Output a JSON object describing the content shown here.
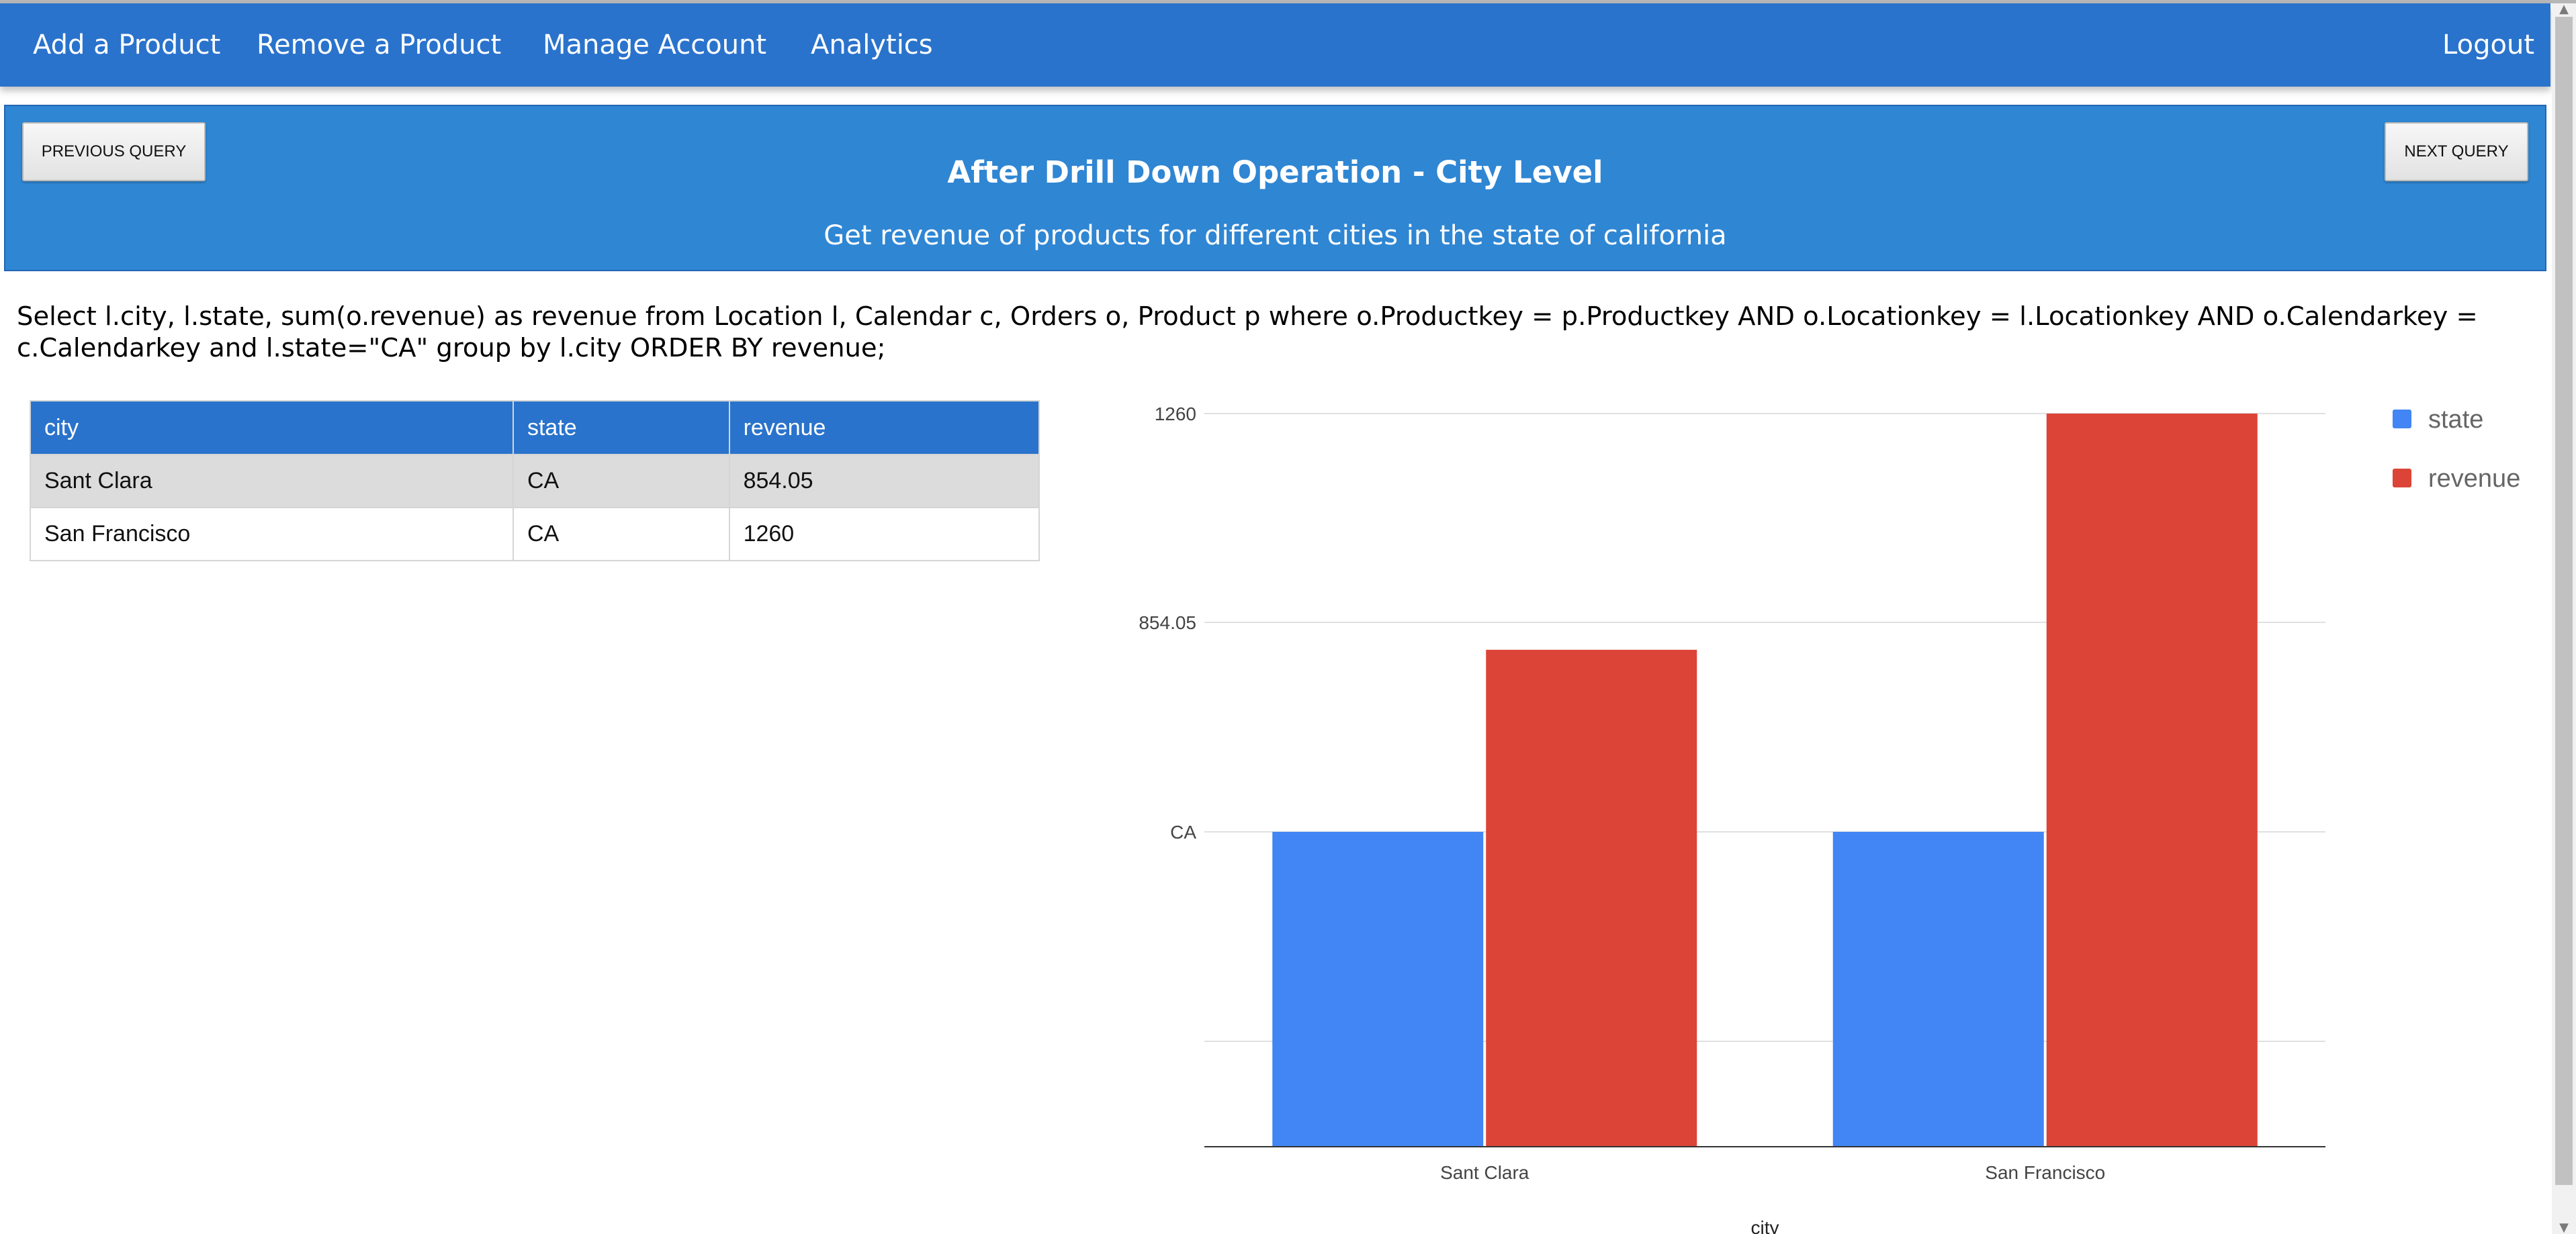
{
  "nav": {
    "items": [
      {
        "label": "Add a Product"
      },
      {
        "label": "Remove a Product"
      },
      {
        "label": "Manage Account"
      },
      {
        "label": "Analytics"
      }
    ],
    "logout": "Logout"
  },
  "query": {
    "prev_label": "PREVIOUS QUERY",
    "next_label": "NEXT QUERY",
    "title": "After Drill Down Operation - City Level",
    "subtitle": "Get revenue of products for different cities in the state of california",
    "sql": "Select l.city, l.state, sum(o.revenue) as revenue from Location l, Calendar c, Orders o, Product p where o.Productkey = p.Productkey AND o.Locationkey = l.Locationkey AND o.Calendarkey = c.Calendarkey and l.state=\"CA\" group by l.city ORDER BY revenue;"
  },
  "table": {
    "headers": [
      "city",
      "state",
      "revenue"
    ],
    "rows": [
      [
        "Sant Clara",
        "CA",
        "854.05"
      ],
      [
        "San Francisco",
        "CA",
        "1260"
      ]
    ]
  },
  "colors": {
    "nav": "#2a73cc",
    "header": "#2f86d3",
    "series_state": "#4285f4",
    "series_revenue": "#db4437"
  },
  "chart_data": {
    "type": "bar",
    "categories": [
      "Sant Clara",
      "San Francisco"
    ],
    "xlabel": "city",
    "series": [
      {
        "name": "state",
        "values": [
          "CA",
          "CA"
        ]
      },
      {
        "name": "revenue",
        "values": [
          854.05,
          1260
        ]
      }
    ],
    "y_ticks": [
      "1260",
      "854.05",
      "CA"
    ],
    "legend": "right",
    "grid": true
  }
}
